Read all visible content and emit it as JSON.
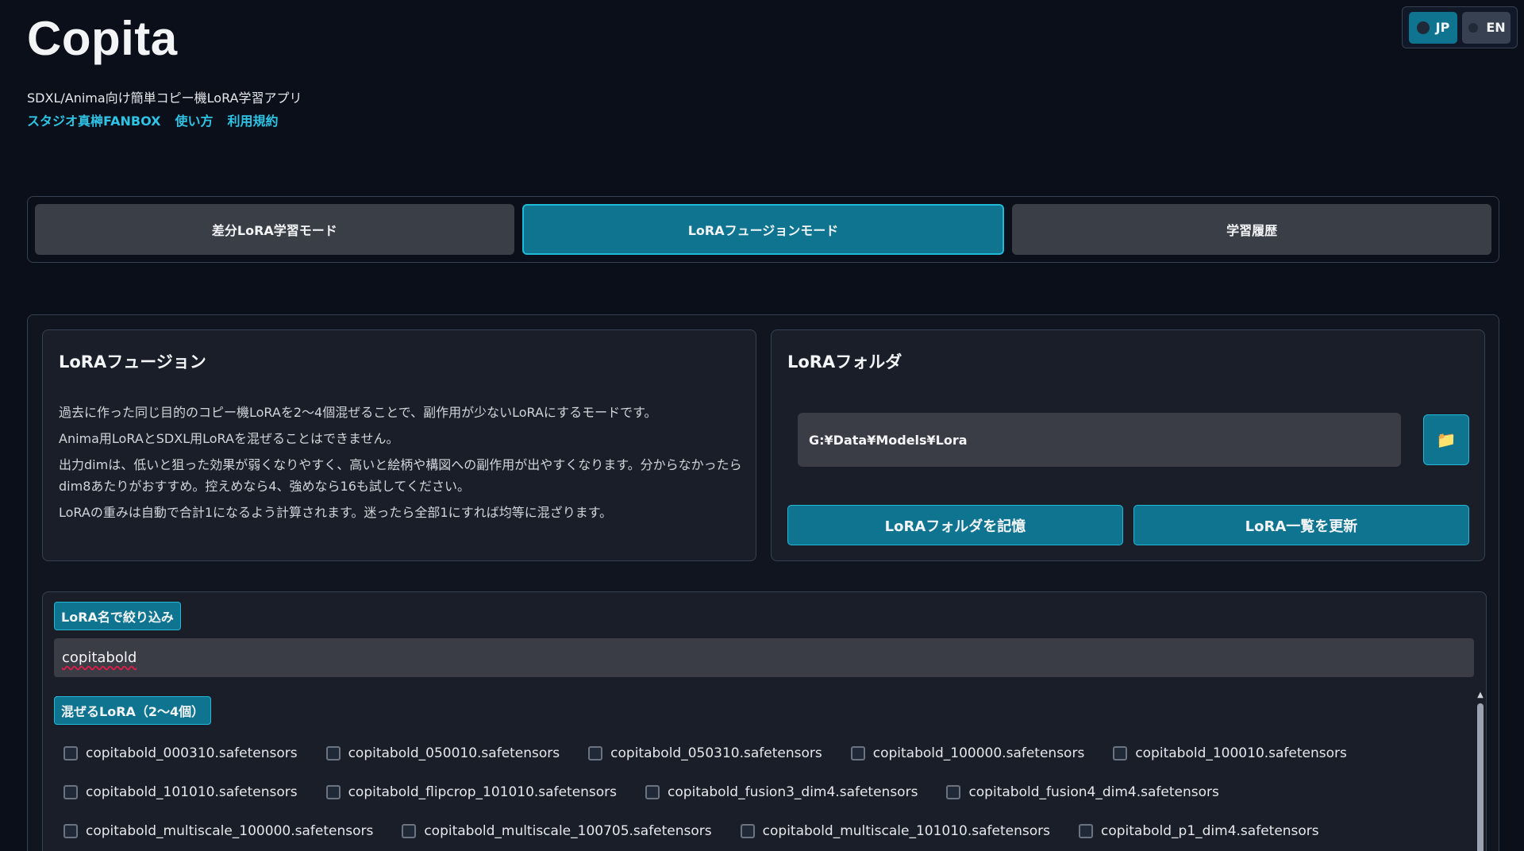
{
  "header": {
    "title": "Copita",
    "subtitle": "SDXL/Anima向け簡単コピー機LoRA学習アプリ",
    "links": [
      "スタジオ真榊FANBOX",
      "使い方",
      "利用規約"
    ]
  },
  "language": {
    "options": [
      {
        "label": "JP",
        "selected": true
      },
      {
        "label": "EN",
        "selected": false
      }
    ]
  },
  "tabs": [
    {
      "label": "差分LoRA学習モード",
      "active": false
    },
    {
      "label": "LoRAフュージョンモード",
      "active": true
    },
    {
      "label": "学習履歴",
      "active": false
    }
  ],
  "info": {
    "title": "LoRAフュージョン",
    "lines": [
      "過去に作った同じ目的のコピー機LoRAを2〜4個混ぜることで、副作用が少ないLoRAにするモードです。",
      "Anima用LoRAとSDXL用LoRAを混ぜることはできません。",
      "出力dimは、低いと狙った効果が弱くなりやすく、高いと絵柄や構図への副作用が出やすくなります。分からなかったらdim8あたりがおすすめ。控えめなら4、強めなら16も試してください。",
      "LoRAの重みは自動で合計1になるよう計算されます。迷ったら全部1にすれば均等に混ざります。"
    ]
  },
  "folder": {
    "title": "LoRAフォルダ",
    "path": "G:¥Data¥Models¥Lora",
    "save_label": "LoRAフォルダを記憶",
    "refresh_label": "LoRA一覧を更新",
    "browse_icon": "folder-icon"
  },
  "filter": {
    "label": "LoRA名で絞り込み",
    "value": "copitabold"
  },
  "mix": {
    "label": "混ぜるLoRA（2〜4個）",
    "rows": [
      [
        "copitabold_000310.safetensors",
        "copitabold_050010.safetensors",
        "copitabold_050310.safetensors",
        "copitabold_100000.safetensors",
        "copitabold_100010.safetensors"
      ],
      [
        "copitabold_101010.safetensors",
        "copitabold_flipcrop_101010.safetensors",
        "copitabold_fusion3_dim4.safetensors",
        "copitabold_fusion4_dim4.safetensors"
      ],
      [
        "copitabold_multiscale_100000.safetensors",
        "copitabold_multiscale_100705.safetensors",
        "copitabold_multiscale_101010.safetensors",
        "copitabold_p1_dim4.safetensors"
      ]
    ]
  }
}
